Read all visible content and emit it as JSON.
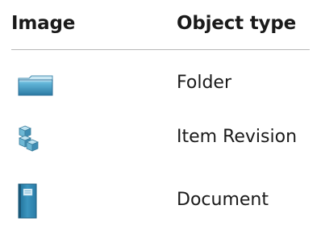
{
  "table": {
    "headers": {
      "image": "Image",
      "object_type": "Object type"
    },
    "rows": [
      {
        "icon": "folder-icon",
        "label": "Folder"
      },
      {
        "icon": "item-revision-icon",
        "label": "Item Revision"
      },
      {
        "icon": "document-icon",
        "label": "Document"
      }
    ]
  },
  "colors": {
    "folder_fill": "#3b8fb5",
    "folder_light": "#8fd0ea",
    "cube_fill": "#5aa9c8",
    "doc_fill": "#2f86b0"
  }
}
